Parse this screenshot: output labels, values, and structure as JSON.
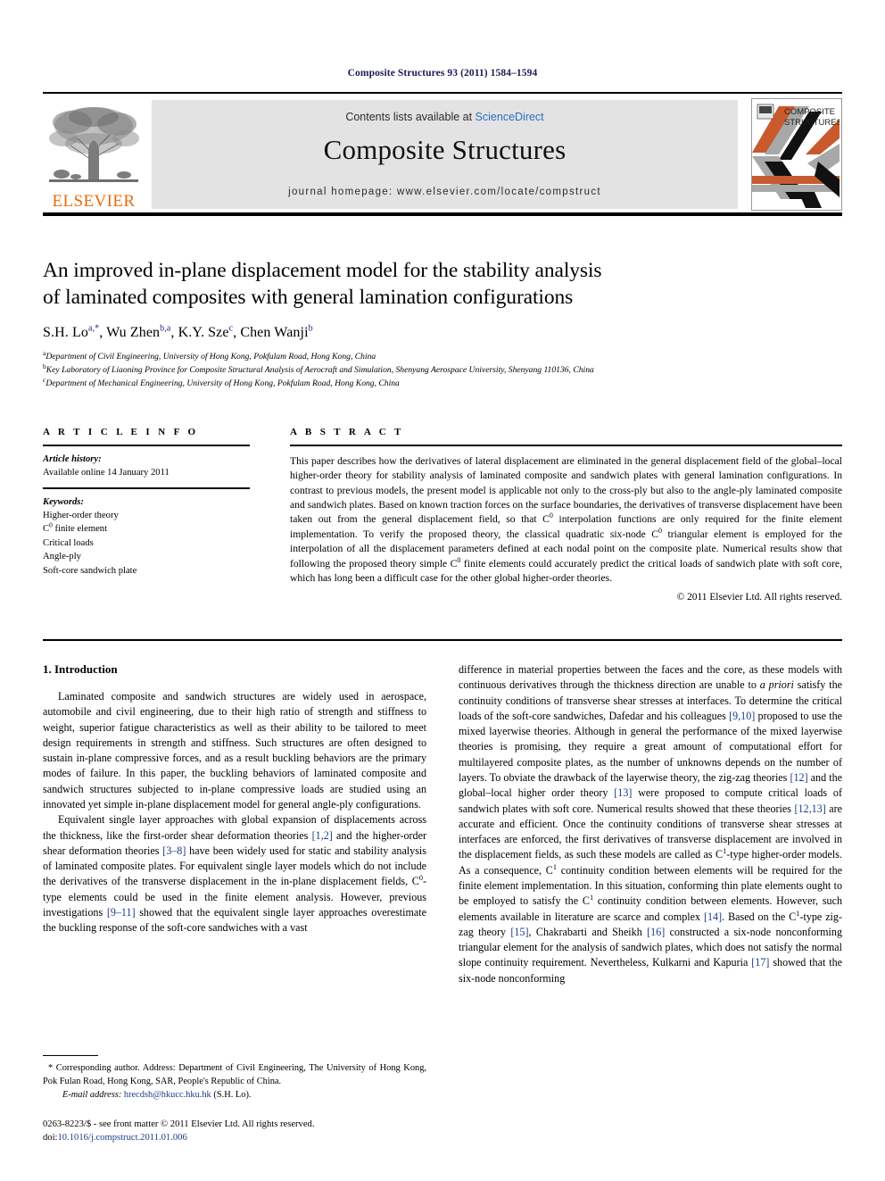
{
  "running_head": "Composite Structures 93 (2011) 1584–1594",
  "masthead": {
    "contents_prefix": "Contents lists available at ",
    "sciencedirect": "ScienceDirect",
    "journal_title": "Composite Structures",
    "homepage": "journal homepage: www.elsevier.com/locate/compstruct",
    "publisher_logo_text": "ELSEVIER",
    "cover_line1": "COMPOSITE",
    "cover_line2": "STRUCTURES",
    "accent_orange": "#c85a2e",
    "accent_gray": "#9a9a9a",
    "elsevier_orange": "#eb6a09",
    "link_blue": "#2b6ec2",
    "panel_gray": "#e3e3e3"
  },
  "title": {
    "line1": "An improved in-plane displacement model for the stability analysis",
    "line2": "of laminated composites with general lamination configurations"
  },
  "authors": [
    {
      "name": "S.H. Lo",
      "sup": "a,*"
    },
    {
      "name": "Wu Zhen",
      "sup": "b,a"
    },
    {
      "name": "K.Y. Sze",
      "sup": "c"
    },
    {
      "name": "Chen Wanji",
      "sup": "b"
    }
  ],
  "affiliations": [
    {
      "mark": "a",
      "text": "Department of Civil Engineering, University of Hong Kong, Pokfulam Road, Hong Kong, China"
    },
    {
      "mark": "b",
      "text": "Key Laboratory of Liaoning Province for Composite Structural Analysis of Aerocraft and Simulation, Shenyang Aerospace University, Shenyang 110136, China"
    },
    {
      "mark": "c",
      "text": "Department of Mechanical Engineering, University of Hong Kong, Pokfulam Road, Hong Kong, China"
    }
  ],
  "article_info": {
    "heading": "A R T I C L E   I N F O",
    "history_label": "Article history:",
    "history_value": "Available online 14 January 2011",
    "keywords_label": "Keywords:",
    "keywords": [
      "Higher-order theory",
      "C0 finite element",
      "Critical loads",
      "Angle-ply",
      "Soft-core sandwich plate"
    ],
    "keyword_c0_base": "C",
    "keyword_c0_sup": "0",
    "keyword_c0_rest": " finite element"
  },
  "abstract": {
    "heading": "A B S T R A C T",
    "p1_a": "This paper describes how the derivatives of lateral displacement are eliminated in the general displacement field of the global–local higher-order theory for stability analysis of laminated composite and sandwich plates with general lamination configurations. In contrast to previous models, the present model is applicable not only to the cross-ply but also to the angle-ply laminated composite and sandwich plates. Based on known traction forces on the surface boundaries, the derivatives of transverse displacement have been taken out from the general displacement field, so that C",
    "sup1": "0",
    "p1_b": " interpolation functions are only required for the finite element implementation. To verify the proposed theory, the classical quadratic six-node C",
    "sup2": "0",
    "p1_c": " triangular element is employed for the interpolation of all the displacement parameters defined at each nodal point on the composite plate. Numerical results show that following the proposed theory simple C",
    "sup3": "0",
    "p1_d": " finite elements could accurately predict the critical loads of sandwich plate with soft core, which has long been a difficult case for the other global higher-order theories.",
    "copyright": "© 2011 Elsevier Ltd. All rights reserved."
  },
  "body": {
    "section_title": "1. Introduction",
    "left": {
      "p1": "Laminated composite and sandwich structures are widely used in aerospace, automobile and civil engineering, due to their high ratio of strength and stiffness to weight, superior fatigue characteristics as well as their ability to be tailored to meet design requirements in strength and stiffness. Such structures are often designed to sustain in-plane compressive forces, and as a result buckling behaviors are the primary modes of failure. In this paper, the buckling behaviors of laminated composite and sandwich structures subjected to in-plane compressive loads are studied using an innovated yet simple in-plane displacement model for general angle-ply configurations.",
      "p2_a": "Equivalent single layer approaches with global expansion of displacements across the thickness, like the first-order shear deformation theories ",
      "ref_12": "[1,2]",
      "p2_b": " and the higher-order shear deformation theories ",
      "ref_38": "[3–8]",
      "p2_c": " have been widely used for static and stability analysis of laminated composite plates. For equivalent single layer models which do not include the derivatives of the transverse displacement in the in-plane displacement fields, C",
      "sup_0": "0",
      "p2_d": "-type elements could be used in the finite element analysis. However, previous investigations ",
      "ref_911": "[9–11]",
      "p2_e": " showed that the equivalent single layer approaches overestimate the buckling response of the soft-core sandwiches with a vast"
    },
    "right": {
      "p3_a": "difference in material properties between the faces and the core, as these models with continuous derivatives through the thickness direction are unable to ",
      "ital_apriori": "a priori",
      "p3_b": " satisfy the continuity conditions of transverse shear stresses at interfaces. To determine the critical loads of the soft-core sandwiches, Dafedar and his colleagues ",
      "ref_910": "[9,10]",
      "p3_c": " proposed to use the mixed layerwise theories. Although in general the performance of the mixed layerwise theories is promising, they require a great amount of computational effort for multilayered composite plates, as the number of unknowns depends on the number of layers. To obviate the drawback of the layerwise theory, the zig-zag theories ",
      "ref_12b": "[12]",
      "p3_d": " and the global–local higher order theory ",
      "ref_13": "[13]",
      "p3_e": " were proposed to compute critical loads of sandwich plates with soft core. Numerical results showed that these theories ",
      "ref_1213": "[12,13]",
      "p3_f": " are accurate and efficient. Once the continuity conditions of transverse shear stresses at interfaces are enforced, the first derivatives of transverse displacement are involved in the displacement fields, as such these models are called as C",
      "sup_1a": "1",
      "p3_g": "-type higher-order models. As a consequence, C",
      "sup_1b": "1",
      "p3_h": " continuity condition between elements will be required for the finite element implementation. In this situation, conforming thin plate elements ought to be employed to satisfy the C",
      "sup_1c": "1",
      "p3_i": " continuity condition between elements. However, such elements available in literature are scarce and complex ",
      "ref_14": "[14]",
      "p3_j": ". Based on the C",
      "sup_1d": "1",
      "p3_k": "-type zig-zag theory ",
      "ref_15": "[15]",
      "p3_l": ", Chakrabarti and Sheikh ",
      "ref_16": "[16]",
      "p3_m": " constructed a six-node nonconforming triangular element for the analysis of sandwich plates, which does not satisfy the normal slope continuity requirement. Nevertheless, Kulkarni and Kapuria ",
      "ref_17": "[17]",
      "p3_n": " showed that the six-node nonconforming"
    }
  },
  "footnote": {
    "star": "*",
    "corresponding": " Corresponding author. Address: Department of Civil Engineering, The University of Hong Kong, Pok Fulan Road, Hong Kong, SAR, People's Republic of China.",
    "email_label": "E-mail address:",
    "email": "hrecdsh@hkucc.hku.hk",
    "email_owner": "(S.H. Lo)."
  },
  "issn": {
    "line1": "0263-8223/$ - see front matter © 2011 Elsevier Ltd. All rights reserved.",
    "doi_label": "doi:",
    "doi_value": "10.1016/j.compstruct.2011.01.006"
  }
}
